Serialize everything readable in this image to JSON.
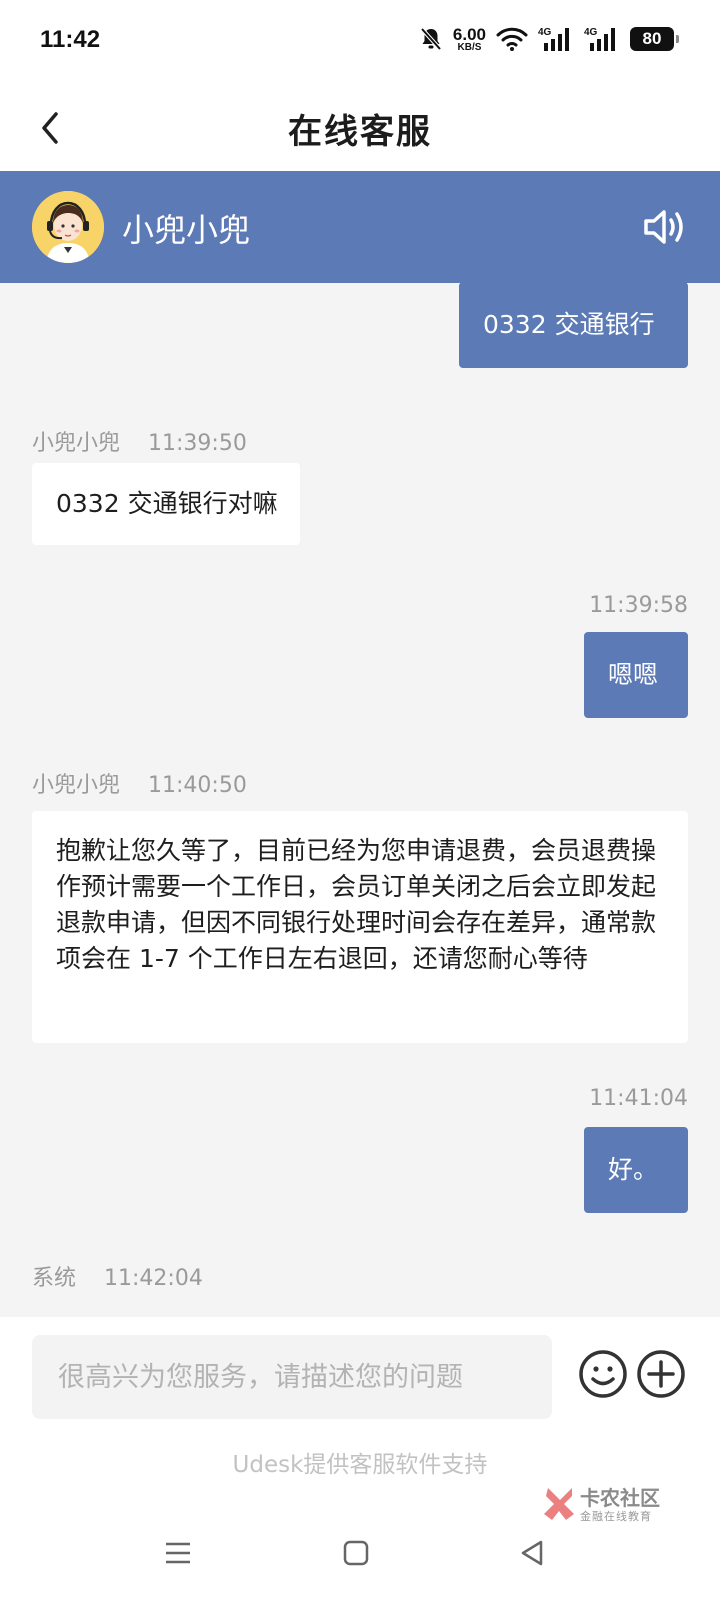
{
  "status_bar": {
    "time": "11:42",
    "net_speed_value": "6.00",
    "net_speed_unit": "KB/S",
    "signal_1": "4G",
    "signal_2": "4G",
    "battery": "80"
  },
  "header": {
    "title": "在线客服"
  },
  "agent": {
    "name": "小兜小兜"
  },
  "messages": [
    {
      "from": "me",
      "text": "0332 交通银行"
    },
    {
      "from": "agent",
      "sender": "小兜小兜",
      "time": "11:39:50",
      "text": "0332 交通银行对嘛"
    },
    {
      "from": "me",
      "time": "11:39:58",
      "text": "嗯嗯"
    },
    {
      "from": "agent",
      "sender": "小兜小兜",
      "time": "11:40:50",
      "text": "抱歉让您久等了，目前已经为您申请退费，会员退费操作预计需要一个工作日，会员订单关闭之后会立即发起退款申请，但因不同银行处理时间会存在差异，通常款项会在 1-7 个工作日左右退回，还请您耐心等待"
    },
    {
      "from": "me",
      "time": "11:41:04",
      "text": "好。"
    },
    {
      "from": "system",
      "sender": "系统",
      "time": "11:42:04",
      "text": ""
    }
  ],
  "composer": {
    "placeholder": "很高兴为您服务，请描述您的问题",
    "value": ""
  },
  "footer": {
    "powered_by": "Udesk提供客服软件支持"
  },
  "watermark": {
    "name": "卡农社区",
    "subtitle": "金融在线教育"
  },
  "colors": {
    "accent": "#5c7ab6",
    "background": "#f4f4f4"
  }
}
